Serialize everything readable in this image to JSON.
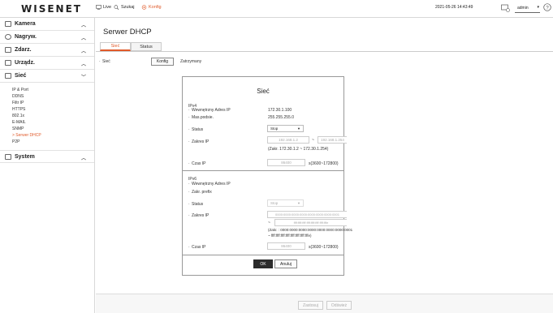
{
  "header": {
    "logo": "WISENET",
    "nav": [
      {
        "label": "Live",
        "icon": "monitor-icon"
      },
      {
        "label": "Szukaj",
        "icon": "search-icon"
      },
      {
        "label": "Konfig",
        "icon": "gear-icon"
      }
    ],
    "datetime": "2021-05-26 14:43:49",
    "user": "admin"
  },
  "sidebar": {
    "sections": [
      {
        "label": "Kamera",
        "icon": "camera-icon"
      },
      {
        "label": "Nagryw.",
        "icon": "record-icon"
      },
      {
        "label": "Zdarz.",
        "icon": "event-icon"
      },
      {
        "label": "Urządz.",
        "icon": "device-icon"
      },
      {
        "label": "Sieć",
        "icon": "network-icon"
      }
    ],
    "network_items": [
      "IP & Port",
      "DDNS",
      "Filtr IP",
      "HTTPS",
      "802.1x",
      "E-MAIL",
      "SNMP",
      "> Serwer DHCP",
      "P2P"
    ],
    "system": {
      "label": "System",
      "icon": "system-icon"
    }
  },
  "page": {
    "title": "Serwer DHCP",
    "tabs": [
      "Sieć",
      "Status"
    ],
    "row_label": "Sieć",
    "config_button": "Konfig",
    "state": "Zatrzymany"
  },
  "modal": {
    "title": "Sieć",
    "ipv4": {
      "heading": "IPv4",
      "internal_ip_label": "Wewnętrzny Adres IP",
      "internal_ip": "172.30.1.100",
      "mask_label": "Mas.podsie.",
      "mask": "255.255.255.0",
      "status_label": "Status",
      "status": "Stop",
      "range_label": "Zakres IP",
      "range_start": "192.168.1.2",
      "range_sep": "~",
      "range_end": "192.168.1.254",
      "range_hint": "(Zakr. 172.30.1.2 ~ 172.30.1.254)",
      "lease_label": "Czas IP",
      "lease": "86400",
      "lease_hint": "s(3600~172800)"
    },
    "ipv6": {
      "heading": "IPv6",
      "internal_ip_label": "Wewnętrzny Adres IP",
      "prefix_label": "Zakr. prefix",
      "status_label": "Status",
      "status": "Stop",
      "range_label": "Zakres IP",
      "range_start": "0000:0000:0000:0000:0000:0000:0000:0001",
      "range_sep": "~",
      "range_end": "ffff:ffff:ffff:ffff:ffff:ffff:ffff:fffe",
      "range_hint_1": "(Zakr. : 0000:0000:0000:0000:0000:0000:0000:0001",
      "range_hint_2": "~ ffff:ffff:ffff:ffff:ffff:ffff:ffff:fffe)",
      "lease_label": "Czas IP",
      "lease": "86400",
      "lease_hint": "s(3600~172800)"
    },
    "ok": "OK",
    "cancel": "Anuluj"
  },
  "footer": {
    "apply": "Zastosuj",
    "refresh": "Odśwież"
  },
  "colors": {
    "accent": "#e05a2a",
    "logo": "#222222"
  }
}
